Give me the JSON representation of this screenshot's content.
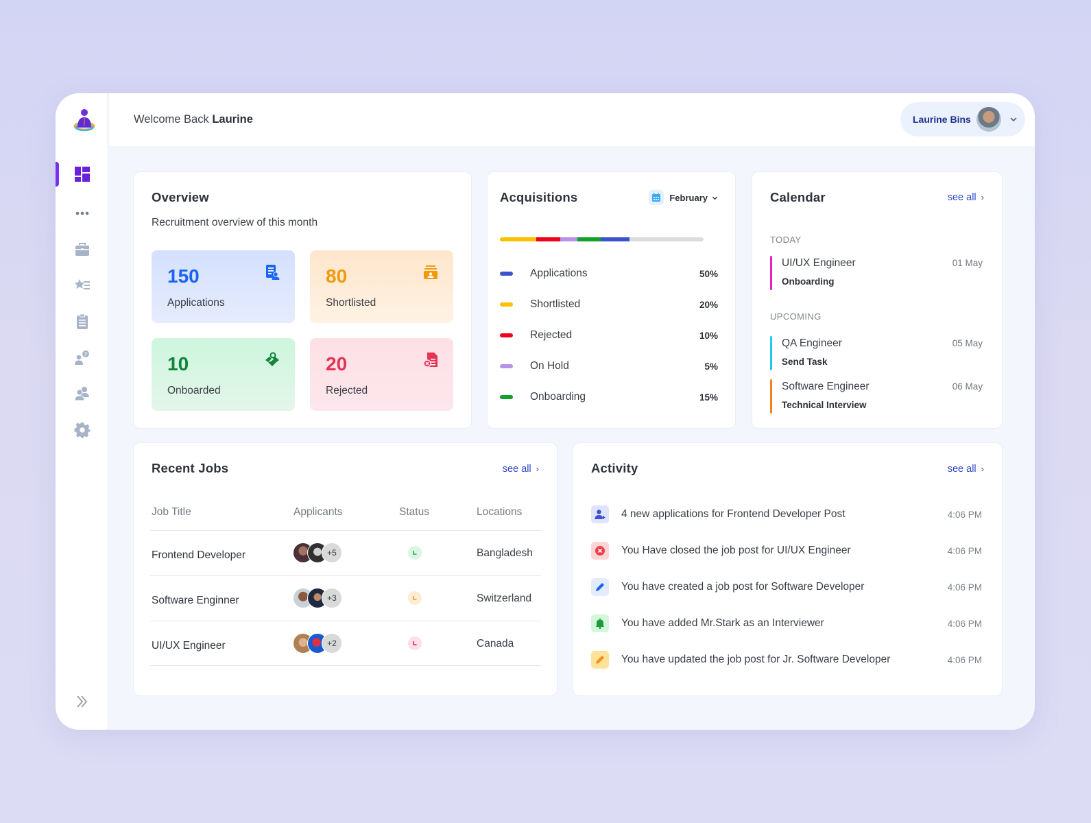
{
  "header": {
    "welcome_prefix": "Welcome Back",
    "welcome_name": "Laurine",
    "user_name": "Laurine Bins"
  },
  "sidebar": {
    "items": [
      {
        "name": "dashboard",
        "icon": "dashboard-icon",
        "active": true
      },
      {
        "name": "more",
        "icon": "more-dots-icon",
        "active": false
      },
      {
        "name": "jobs",
        "icon": "briefcase-icon",
        "active": false
      },
      {
        "name": "shortlist",
        "icon": "star-list-icon",
        "active": false
      },
      {
        "name": "tasks",
        "icon": "clipboard-icon",
        "active": false
      },
      {
        "name": "interviews",
        "icon": "user-question-icon",
        "active": false
      },
      {
        "name": "team",
        "icon": "users-icon",
        "active": false
      },
      {
        "name": "settings",
        "icon": "gear-icon",
        "active": false
      }
    ],
    "collapse_icon": "double-chevron-right-icon"
  },
  "overview": {
    "title": "Overview",
    "subtitle": "Recruitment overview of this month",
    "stats": [
      {
        "value": "150",
        "label": "Applications",
        "icon": "application-doc-icon",
        "color": "#1a64f0"
      },
      {
        "value": "80",
        "label": "Shortlisted",
        "icon": "shortlist-tray-icon",
        "color": "#f19a0a"
      },
      {
        "value": "10",
        "label": "Onboarded",
        "icon": "handshake-icon",
        "color": "#12843b"
      },
      {
        "value": "20",
        "label": "Rejected",
        "icon": "rejected-doc-icon",
        "color": "#e43355"
      }
    ]
  },
  "acquisitions": {
    "title": "Acquisitions",
    "month": "February",
    "bar_segments": [
      {
        "label": "Shortlisted",
        "color": "#fcc000",
        "fraction": 0.18
      },
      {
        "label": "Rejected",
        "color": "#f0001e",
        "fraction": 0.115
      },
      {
        "label": "On Hold",
        "color": "#b792e6",
        "fraction": 0.085
      },
      {
        "label": "Onboarding",
        "color": "#11a02a",
        "fraction": 0.115
      },
      {
        "label": "Applications",
        "color": "#3c52cc",
        "fraction": 0.14
      }
    ],
    "legend": [
      {
        "label": "Applications",
        "percent": "50%",
        "color": "#3c52cc"
      },
      {
        "label": "Shortlisted",
        "percent": "20%",
        "color": "#fcc000"
      },
      {
        "label": "Rejected",
        "percent": "10%",
        "color": "#f0001e"
      },
      {
        "label": "On Hold",
        "percent": "5%",
        "color": "#b792e6"
      },
      {
        "label": "Onboarding",
        "percent": "15%",
        "color": "#11a02a"
      }
    ]
  },
  "calendar": {
    "title": "Calendar",
    "see_all": "see all",
    "today_label": "TODAY",
    "upcoming_label": "UPCOMING",
    "today": [
      {
        "title": "UI/UX Engineer",
        "subtitle": "Onboarding",
        "date": "01 May",
        "color": "#ea1fc3"
      }
    ],
    "upcoming": [
      {
        "title": "QA Engineer",
        "subtitle": "Send Task",
        "date": "05 May",
        "color": "#1dcbf2"
      },
      {
        "title": "Software Engineer",
        "subtitle": "Technical Interview",
        "date": "06 May",
        "color": "#f5821f"
      }
    ]
  },
  "recent_jobs": {
    "title": "Recent Jobs",
    "see_all": "see all",
    "columns": [
      "Job Title",
      "Applicants",
      "Status",
      "Locations"
    ],
    "rows": [
      {
        "title": "Frontend Developer",
        "extra_applicants": "+5",
        "status": "green",
        "status_color": "#2db85b",
        "status_bg": "#dcf5e3",
        "location": "Bangladesh"
      },
      {
        "title": "Software Enginner",
        "extra_applicants": "+3",
        "status": "orange",
        "status_color": "#f5a623",
        "status_bg": "#fdecd4",
        "location": "Switzerland"
      },
      {
        "title": "UI/UX Engineer",
        "extra_applicants": "+2",
        "status": "pink",
        "status_color": "#ec3d6a",
        "status_bg": "#fde0e8",
        "location": "Canada"
      }
    ]
  },
  "activity": {
    "title": "Activity",
    "see_all": "see all",
    "items": [
      {
        "text": "4 new applications for Frontend Developer Post",
        "time": "4:06 PM",
        "icon": "user-add-icon"
      },
      {
        "text": "You Have closed the job post for UI/UX Engineer",
        "time": "4:06 PM",
        "icon": "close-circle-icon"
      },
      {
        "text": "You have created a job post for Software Developer",
        "time": "4:06 PM",
        "icon": "pencil-icon"
      },
      {
        "text": "You have added Mr.Stark as an Interviewer",
        "time": "4:06 PM",
        "icon": "bell-icon"
      },
      {
        "text": "You have updated the job post for Jr. Software Developer",
        "time": "4:06 PM",
        "icon": "edit-pencil-icon"
      }
    ]
  }
}
